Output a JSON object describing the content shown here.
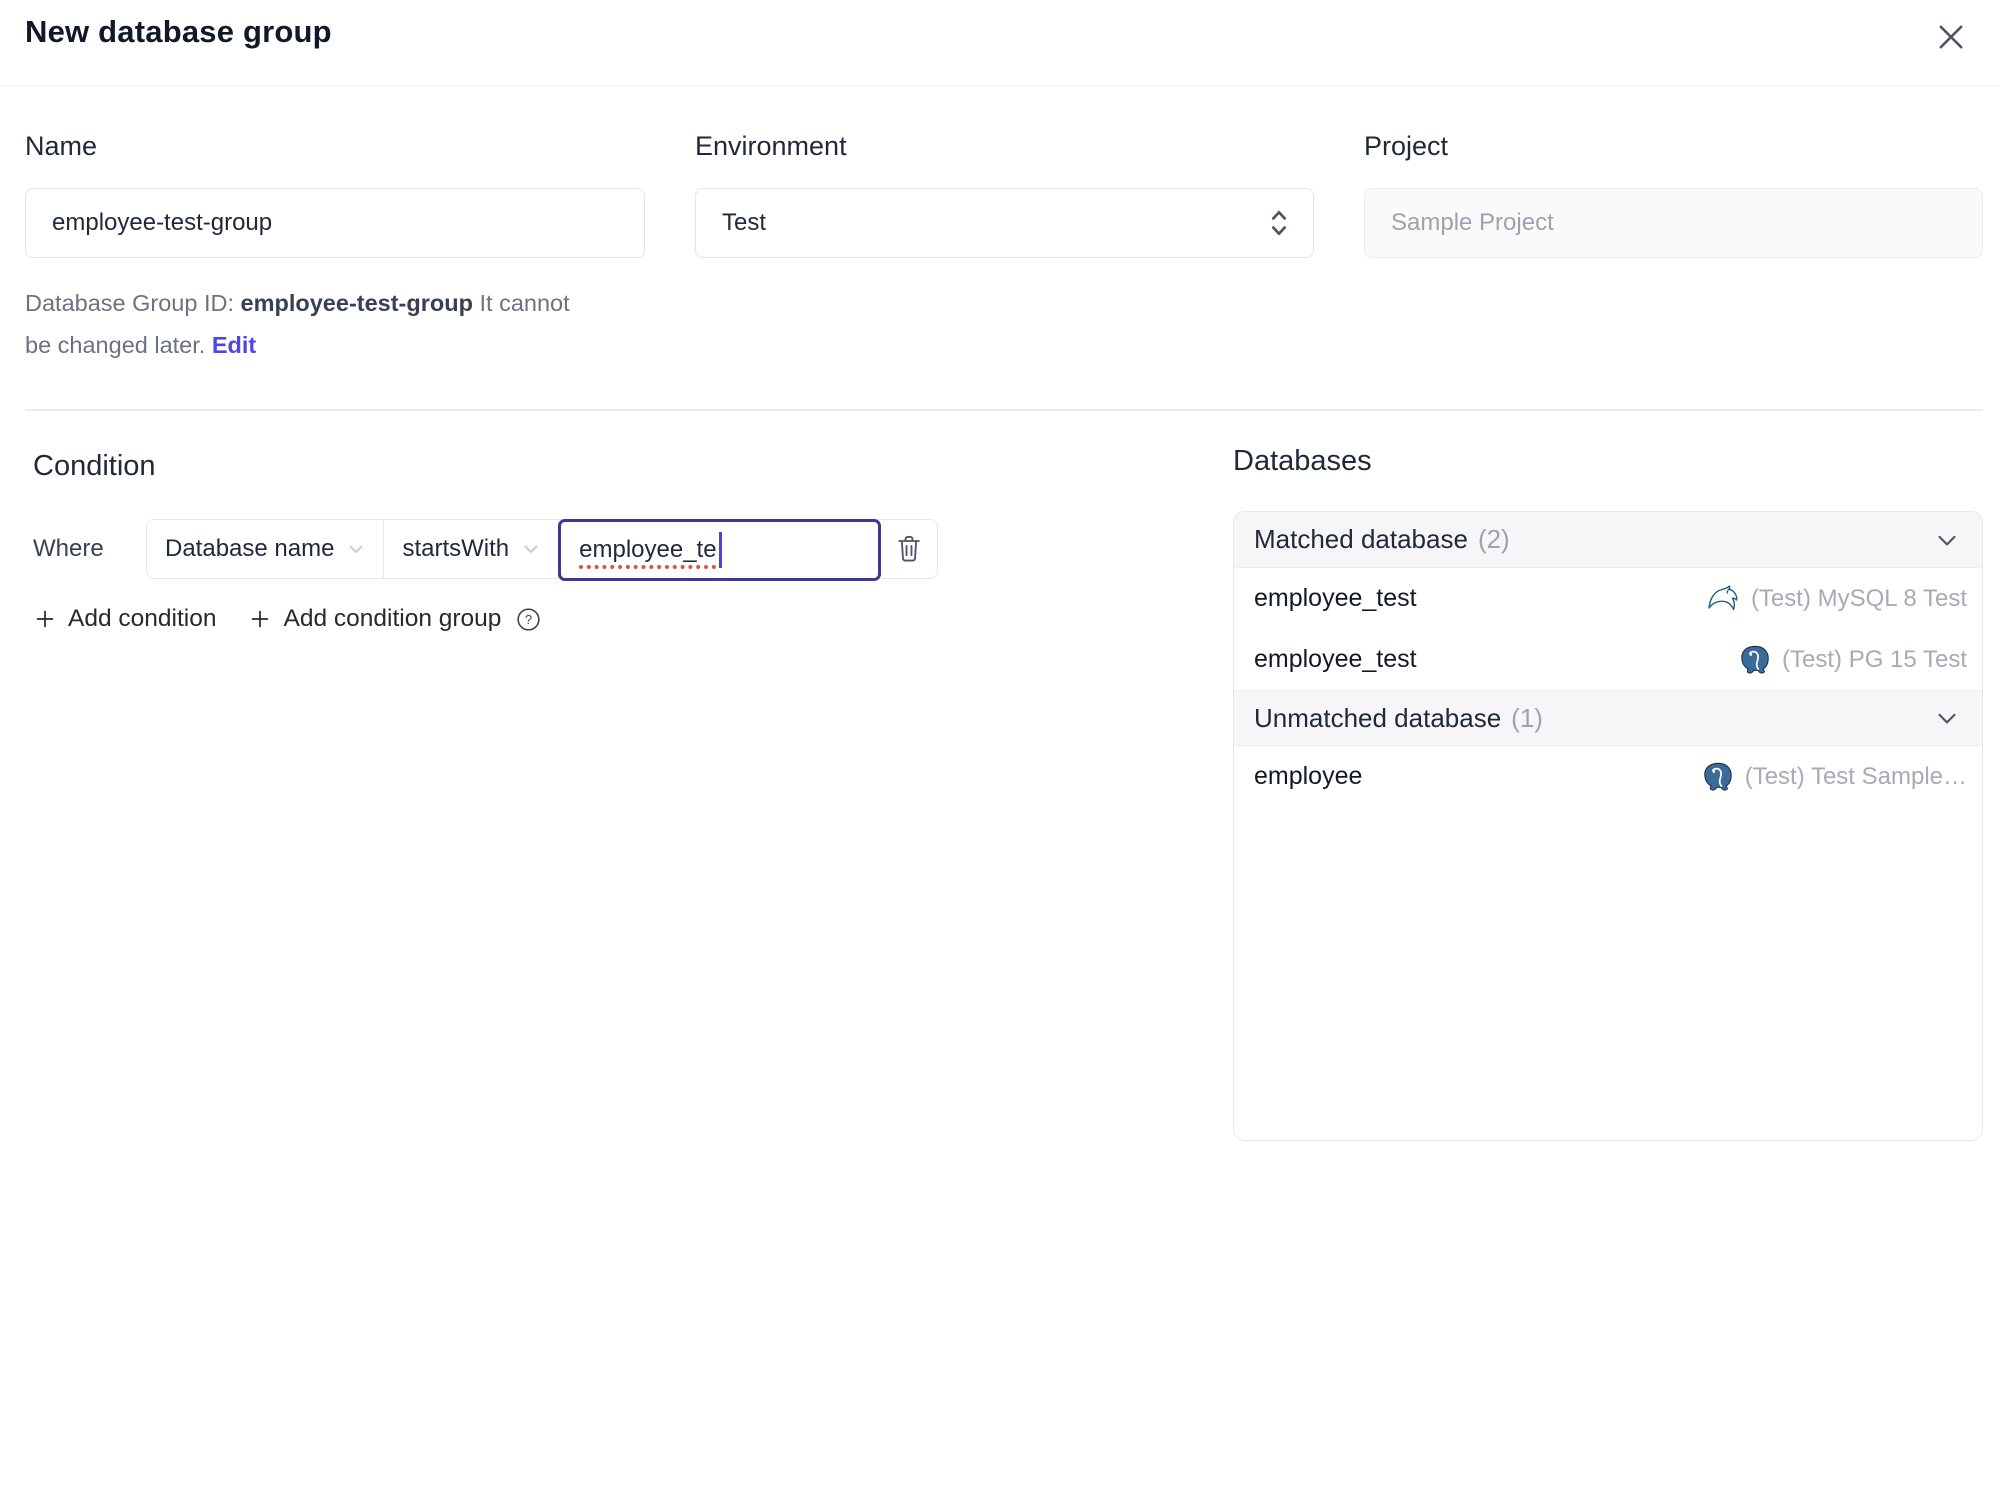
{
  "dialog": {
    "title": "New database group"
  },
  "form": {
    "name": {
      "label": "Name",
      "value": "employee-test-group"
    },
    "environment": {
      "label": "Environment",
      "value": "Test"
    },
    "project": {
      "label": "Project",
      "value": "Sample Project"
    },
    "id_help": {
      "prefix": "Database Group ID: ",
      "id": "employee-test-group",
      "suffix_line1": " It cannot",
      "suffix_line2": "be changed later. ",
      "edit": "Edit"
    }
  },
  "condition": {
    "heading": "Condition",
    "where_label": "Where",
    "field": "Database name",
    "operator": "startsWith",
    "value": "employee_te",
    "add_condition": "Add condition",
    "add_condition_group": "Add condition group"
  },
  "databases": {
    "heading": "Databases",
    "groups": [
      {
        "title": "Matched database",
        "count": "(2)",
        "rows": [
          {
            "name": "employee_test",
            "engine": "mysql-icon",
            "instance": "(Test) MySQL 8 Test"
          },
          {
            "name": "employee_test",
            "engine": "postgresql-icon",
            "instance": "(Test) PG 15 Test"
          }
        ]
      },
      {
        "title": "Unmatched database",
        "count": "(1)",
        "rows": [
          {
            "name": "employee",
            "engine": "postgresql-icon",
            "instance": "(Test) Test Sample…"
          }
        ]
      }
    ]
  },
  "icons": {
    "close": "×",
    "select_arrows": "⌃⌄",
    "dropdown_chevron": "⌄",
    "collapse_chevron": "⌄",
    "trash": "trash-outline",
    "plus": "+",
    "help": "?",
    "mysql": "dolphin-outline",
    "postgresql": "elephant-blue"
  },
  "colors": {
    "accent_indigo": "#4f46e5",
    "focus_border": "#3c3a90",
    "spellcheck_red": "#dd5146",
    "mysql_teal": "#1c5d7a",
    "postgres_blue": "#3a6b9b",
    "border_gray": "#e5e7eb",
    "header_bg": "#f6f6f8",
    "text_dark": "#1f2937",
    "text_gray": "#6b7280",
    "text_light_gray": "#9ca3af"
  }
}
